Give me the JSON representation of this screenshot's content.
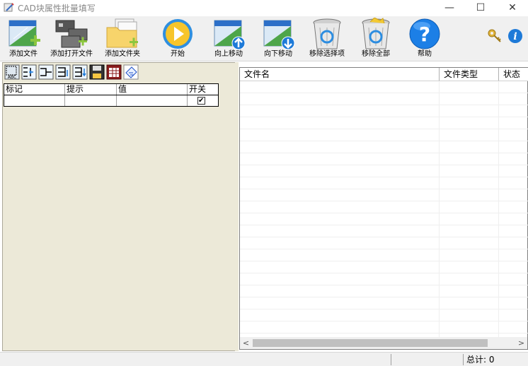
{
  "window": {
    "title": "CAD块属性批量填写",
    "minimize_glyph": "—",
    "maximize_glyph": "☐",
    "close_glyph": "✕"
  },
  "toolbar": {
    "buttons": [
      {
        "label": "添加文件",
        "icon": "add-file-icon"
      },
      {
        "label": "添加打开文件",
        "icon": "add-open-files-icon"
      },
      {
        "label": "添加文件夹",
        "icon": "add-folder-icon"
      },
      {
        "label": "开始",
        "icon": "play-icon"
      },
      {
        "label": "向上移动",
        "icon": "move-up-icon"
      },
      {
        "label": "向下移动",
        "icon": "move-down-icon"
      },
      {
        "label": "移除选择项",
        "icon": "recycle-bin-icon"
      },
      {
        "label": "移除全部",
        "icon": "recycle-bin-full-icon"
      },
      {
        "label": "帮助",
        "icon": "help-icon"
      }
    ],
    "right_icons": [
      "key-icon",
      "info-icon"
    ]
  },
  "property_table": {
    "headers": [
      "标记",
      "提示",
      "值",
      "开关"
    ],
    "rows": [
      {
        "tag": "",
        "prompt": "",
        "value": "",
        "enabled": true
      }
    ],
    "check_glyph": "✔"
  },
  "file_list": {
    "headers": [
      "文件名",
      "文件类型",
      "状态"
    ],
    "rows": []
  },
  "scrollbar": {
    "left_arrow": "<",
    "right_arrow": ">"
  },
  "status": {
    "total_label": "总计: 0"
  }
}
